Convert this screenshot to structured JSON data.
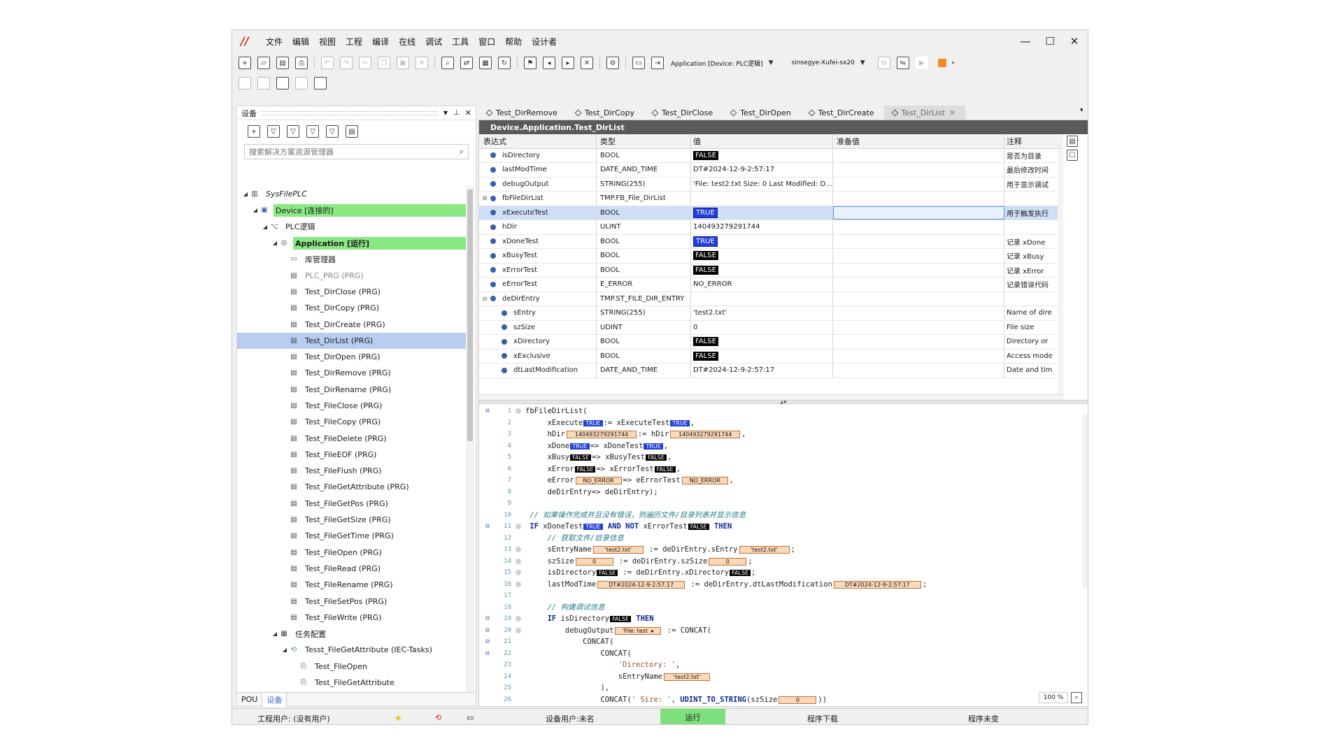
{
  "menu": [
    "文件",
    "编辑",
    "视图",
    "工程",
    "编译",
    "在线",
    "调试",
    "工具",
    "窗口",
    "帮助",
    "设计者"
  ],
  "toolbar": {
    "application_dropdown": "Application [Device: PLC逻辑]",
    "user_dropdown": "sinsegye-Xufei-sx20"
  },
  "left_panel": {
    "title": "设备",
    "search_placeholder": "搜索解决方案资源管理器",
    "tree": [
      {
        "label": "SysFilePLC",
        "level": 0,
        "exp": "◢",
        "icon": "project-icon",
        "italic": true
      },
      {
        "label": "Device [连接的]",
        "level": 1,
        "exp": "◢",
        "icon": "device-icon",
        "hl": "green"
      },
      {
        "label": "PLC逻辑",
        "level": 2,
        "exp": "◢",
        "icon": "plc-logic-icon"
      },
      {
        "label": "Application [运行]",
        "level": 3,
        "exp": "◢",
        "icon": "application-icon",
        "hl": "green",
        "bold": true
      },
      {
        "label": "库管理器",
        "level": 4,
        "exp": "",
        "icon": "library-manager-icon"
      },
      {
        "label": "PLC_PRG (PRG)",
        "level": 4,
        "exp": "",
        "icon": "pou-icon",
        "dim": true
      },
      {
        "label": "Test_DirClose (PRG)",
        "level": 4,
        "exp": "",
        "icon": "pou-icon"
      },
      {
        "label": "Test_DirCopy (PRG)",
        "level": 4,
        "exp": "",
        "icon": "pou-icon"
      },
      {
        "label": "Test_DirCreate (PRG)",
        "level": 4,
        "exp": "",
        "icon": "pou-icon"
      },
      {
        "label": "Test_DirList (PRG)",
        "level": 4,
        "exp": "",
        "icon": "pou-icon",
        "hl": "sel"
      },
      {
        "label": "Test_DirOpen (PRG)",
        "level": 4,
        "exp": "",
        "icon": "pou-icon"
      },
      {
        "label": "Test_DirRemove (PRG)",
        "level": 4,
        "exp": "",
        "icon": "pou-icon"
      },
      {
        "label": "Test_DirRename (PRG)",
        "level": 4,
        "exp": "",
        "icon": "pou-icon"
      },
      {
        "label": "Test_FileClose (PRG)",
        "level": 4,
        "exp": "",
        "icon": "pou-icon"
      },
      {
        "label": "Test_FileCopy (PRG)",
        "level": 4,
        "exp": "",
        "icon": "pou-icon"
      },
      {
        "label": "Test_FileDelete (PRG)",
        "level": 4,
        "exp": "",
        "icon": "pou-icon"
      },
      {
        "label": "Test_FileEOF (PRG)",
        "level": 4,
        "exp": "",
        "icon": "pou-icon"
      },
      {
        "label": "Test_FileFlush (PRG)",
        "level": 4,
        "exp": "",
        "icon": "pou-icon"
      },
      {
        "label": "Test_FileGetAttribute (PRG)",
        "level": 4,
        "exp": "",
        "icon": "pou-icon"
      },
      {
        "label": "Test_FileGetPos (PRG)",
        "level": 4,
        "exp": "",
        "icon": "pou-icon"
      },
      {
        "label": "Test_FileGetSize (PRG)",
        "level": 4,
        "exp": "",
        "icon": "pou-icon"
      },
      {
        "label": "Test_FileGetTime (PRG)",
        "level": 4,
        "exp": "",
        "icon": "pou-icon"
      },
      {
        "label": "Test_FileOpen (PRG)",
        "level": 4,
        "exp": "",
        "icon": "pou-icon"
      },
      {
        "label": "Test_FileRead (PRG)",
        "level": 4,
        "exp": "",
        "icon": "pou-icon"
      },
      {
        "label": "Test_FileRename (PRG)",
        "level": 4,
        "exp": "",
        "icon": "pou-icon"
      },
      {
        "label": "Test_FileSetPos (PRG)",
        "level": 4,
        "exp": "",
        "icon": "pou-icon"
      },
      {
        "label": "Test_FileWrite (PRG)",
        "level": 4,
        "exp": "",
        "icon": "pou-icon"
      },
      {
        "label": "任务配置",
        "level": 3,
        "exp": "◢",
        "icon": "task-config-icon"
      },
      {
        "label": "Tesst_FileGetAttribute (IEC-Tasks)",
        "level": 4,
        "exp": "◢",
        "icon": "task-icon"
      },
      {
        "label": "Test_FileOpen",
        "level": 5,
        "exp": "",
        "icon": "program-call-icon"
      },
      {
        "label": "Test_FileGetAttribute",
        "level": 5,
        "exp": "",
        "icon": "program-call-icon"
      }
    ],
    "tabs": [
      "POU",
      "设备"
    ]
  },
  "editor_tabs": [
    "Test_DirRemove",
    "Test_DirCopy",
    "Test_DirClose",
    "Test_DirOpen",
    "Test_DirCreate",
    "Test_DirList"
  ],
  "editor": {
    "path": "Device.Application.Test_DirList",
    "columns": [
      "表达式",
      "类型",
      "值",
      "准备值",
      "注释"
    ],
    "rows": [
      {
        "name": "isDirectory",
        "type": "BOOL",
        "value": "FALSE",
        "vstyle": "f",
        "comment": "是否为目录",
        "indent": 0,
        "exp": ""
      },
      {
        "name": "lastModTime",
        "type": "DATE_AND_TIME",
        "value": "DT#2024-12-9-2:57:17",
        "vstyle": "",
        "comment": "最后修改时间",
        "indent": 0,
        "exp": ""
      },
      {
        "name": "debugOutput",
        "type": "STRING(255)",
        "value": "'File: test2.txt Size: 0 Last Modified: D...",
        "vstyle": "",
        "comment": "用于显示调试",
        "indent": 0,
        "exp": ""
      },
      {
        "name": "fbFileDirList",
        "type": "TMP.FB_File_DirList",
        "value": "",
        "vstyle": "",
        "comment": "",
        "indent": 0,
        "exp": "⊞"
      },
      {
        "name": "xExecuteTest",
        "type": "BOOL",
        "value": "TRUE",
        "vstyle": "t",
        "comment": "用于触发执行",
        "indent": 0,
        "exp": "",
        "selected": true
      },
      {
        "name": "hDir",
        "type": "ULINT",
        "value": "140493279291744",
        "vstyle": "",
        "comment": "",
        "indent": 0,
        "exp": ""
      },
      {
        "name": "xDoneTest",
        "type": "BOOL",
        "value": "TRUE",
        "vstyle": "t",
        "comment": "记录 xDone",
        "indent": 0,
        "exp": ""
      },
      {
        "name": "xBusyTest",
        "type": "BOOL",
        "value": "FALSE",
        "vstyle": "f",
        "comment": "记录 xBusy",
        "indent": 0,
        "exp": ""
      },
      {
        "name": "xErrorTest",
        "type": "BOOL",
        "value": "FALSE",
        "vstyle": "f",
        "comment": "记录 xError",
        "indent": 0,
        "exp": ""
      },
      {
        "name": "eErrorTest",
        "type": "E_ERROR",
        "value": "NO_ERROR",
        "vstyle": "",
        "comment": "记录错误代码",
        "indent": 0,
        "exp": ""
      },
      {
        "name": "deDirEntry",
        "type": "TMP.ST_FILE_DIR_ENTRY",
        "value": "",
        "vstyle": "",
        "comment": "",
        "indent": 0,
        "exp": "⊟"
      },
      {
        "name": "sEntry",
        "type": "STRING(255)",
        "value": "'test2.txt'",
        "vstyle": "",
        "comment": "Name of dire",
        "indent": 1,
        "exp": ""
      },
      {
        "name": "szSize",
        "type": "UDINT",
        "value": "0",
        "vstyle": "",
        "comment": "File size",
        "indent": 1,
        "exp": ""
      },
      {
        "name": "xDirectory",
        "type": "BOOL",
        "value": "FALSE",
        "vstyle": "f",
        "comment": "Directory or",
        "indent": 1,
        "exp": ""
      },
      {
        "name": "xExclusive",
        "type": "BOOL",
        "value": "FALSE",
        "vstyle": "f",
        "comment": "Access mode",
        "indent": 1,
        "exp": ""
      },
      {
        "name": "dtLastModification",
        "type": "DATE_AND_TIME",
        "value": "DT#2024-12-9-2:57:17",
        "vstyle": "",
        "comment": "Date and tim",
        "indent": 1,
        "exp": ""
      }
    ],
    "code": [
      {
        "n": "1",
        "g": "⊟",
        "bp": true,
        "parts": [
          [
            "t",
            "fbFileDirList("
          ]
        ]
      },
      {
        "n": "2",
        "g": "",
        "bp": false,
        "parts": [
          [
            "t",
            "     xExecute"
          ],
          [
            "bt",
            "TRUE"
          ],
          [
            "t",
            ":= xExecuteTest"
          ],
          [
            "bt",
            "TRUE"
          ],
          [
            "t",
            ","
          ]
        ]
      },
      {
        "n": "3",
        "g": "",
        "bp": false,
        "parts": [
          [
            "t",
            "     hDir"
          ],
          [
            "bo",
            "140493279291744",
            100
          ],
          [
            "t",
            ":= hDir"
          ],
          [
            "bo",
            "140493279291744",
            100
          ],
          [
            "t",
            ","
          ]
        ]
      },
      {
        "n": "4",
        "g": "",
        "bp": false,
        "parts": [
          [
            "t",
            "     xDone"
          ],
          [
            "bt",
            "TRUE"
          ],
          [
            "t",
            "=> xDoneTest"
          ],
          [
            "bt",
            "TRUE"
          ],
          [
            "t",
            ","
          ]
        ]
      },
      {
        "n": "5",
        "g": "",
        "bp": false,
        "parts": [
          [
            "t",
            "     xBusy"
          ],
          [
            "bf",
            "FALSE"
          ],
          [
            "t",
            "=> xBusyTest"
          ],
          [
            "bf",
            "FALSE"
          ],
          [
            "t",
            ","
          ]
        ]
      },
      {
        "n": "6",
        "g": "",
        "bp": false,
        "parts": [
          [
            "t",
            "     xError"
          ],
          [
            "bf",
            "FALSE"
          ],
          [
            "t",
            "=> xErrorTest"
          ],
          [
            "bf",
            "FALSE"
          ],
          [
            "t",
            ","
          ]
        ]
      },
      {
        "n": "7",
        "g": "",
        "bp": false,
        "parts": [
          [
            "t",
            "     eError"
          ],
          [
            "bo",
            "NO_ERROR",
            66
          ],
          [
            "t",
            "=> eErrorTest"
          ],
          [
            "bo",
            "NO_ERROR",
            66
          ],
          [
            "t",
            ","
          ]
        ]
      },
      {
        "n": "8",
        "g": "",
        "bp": false,
        "parts": [
          [
            "t",
            "     deDirEntry=> deDirEntry);"
          ]
        ]
      },
      {
        "n": "9",
        "g": "",
        "bp": false,
        "parts": [
          [
            "t",
            ""
          ]
        ]
      },
      {
        "n": "10",
        "g": "",
        "bp": false,
        "parts": [
          [
            "c",
            " // 如果操作完成并且没有错误，则遍历文件/目录列表并显示信息"
          ]
        ]
      },
      {
        "n": "11",
        "g": "⊟",
        "bp": true,
        "parts": [
          [
            "k",
            " IF "
          ],
          [
            "t",
            "xDoneTest"
          ],
          [
            "bt",
            "TRUE"
          ],
          [
            "k",
            " AND NOT "
          ],
          [
            "t",
            "xErrorTest"
          ],
          [
            "bf",
            "FALSE"
          ],
          [
            "k",
            " THEN"
          ]
        ]
      },
      {
        "n": "12",
        "g": "",
        "bp": false,
        "parts": [
          [
            "c",
            "     // 获取文件/目录信息"
          ]
        ]
      },
      {
        "n": "13",
        "g": "",
        "bp": true,
        "parts": [
          [
            "t",
            "     sEntryName"
          ],
          [
            "bo",
            "'test2.txt'",
            72
          ],
          [
            "t",
            " := deDirEntry.sEntry"
          ],
          [
            "bo",
            "'test2.txt'",
            72
          ],
          [
            "t",
            ";"
          ]
        ]
      },
      {
        "n": "14",
        "g": "",
        "bp": true,
        "parts": [
          [
            "t",
            "     szSize"
          ],
          [
            "bo",
            "0",
            54
          ],
          [
            "t",
            " := deDirEntry.szSize"
          ],
          [
            "bo",
            "0",
            54
          ],
          [
            "t",
            ";"
          ]
        ]
      },
      {
        "n": "15",
        "g": "",
        "bp": true,
        "parts": [
          [
            "t",
            "     isDirectory"
          ],
          [
            "bf",
            "FALSE"
          ],
          [
            "t",
            " := deDirEntry.xDirectory"
          ],
          [
            "bf",
            "FALSE"
          ],
          [
            "t",
            ";"
          ]
        ]
      },
      {
        "n": "16",
        "g": "",
        "bp": true,
        "parts": [
          [
            "t",
            "     lastModTime"
          ],
          [
            "bo",
            "DT#2024-12-9-2:57:17",
            125
          ],
          [
            "t",
            " := deDirEntry.dtLastModification"
          ],
          [
            "bo",
            "DT#2024-12-9-2:57:17",
            125
          ],
          [
            "t",
            ";"
          ]
        ]
      },
      {
        "n": "17",
        "g": "",
        "bp": false,
        "parts": [
          [
            "t",
            ""
          ]
        ]
      },
      {
        "n": "18",
        "g": "",
        "bp": false,
        "parts": [
          [
            "c",
            "     // 构建调试信息"
          ]
        ]
      },
      {
        "n": "19",
        "g": "⊟",
        "bp": true,
        "parts": [
          [
            "k",
            "     IF "
          ],
          [
            "t",
            "isDirectory"
          ],
          [
            "bf",
            "FALSE"
          ],
          [
            "k",
            " THEN"
          ]
        ]
      },
      {
        "n": "20",
        "g": "⊟",
        "bp": true,
        "parts": [
          [
            "t",
            "         debugOutput"
          ],
          [
            "bo",
            "'File: test  ▸",
            66
          ],
          [
            "t",
            " := CONCAT("
          ]
        ]
      },
      {
        "n": "21",
        "g": "⊟",
        "bp": false,
        "parts": [
          [
            "t",
            "             CONCAT("
          ]
        ]
      },
      {
        "n": "22",
        "g": "⊟",
        "bp": false,
        "parts": [
          [
            "t",
            "                 CONCAT("
          ]
        ]
      },
      {
        "n": "23",
        "g": "",
        "bp": false,
        "parts": [
          [
            "s",
            "                     'Directory: '"
          ],
          [
            "t",
            ","
          ]
        ]
      },
      {
        "n": "24",
        "g": "",
        "bp": false,
        "parts": [
          [
            "t",
            "                     sEntryName"
          ],
          [
            "bo",
            "'test2.txt'",
            66
          ]
        ]
      },
      {
        "n": "25",
        "g": "",
        "bp": false,
        "parts": [
          [
            "t",
            "                 ),"
          ]
        ]
      },
      {
        "n": "26",
        "g": "",
        "bp": false,
        "parts": [
          [
            "t",
            "                 CONCAT("
          ],
          [
            "s",
            "' Size: '"
          ],
          [
            "t",
            ", "
          ],
          [
            "k",
            "UDINT_TO_STRING"
          ],
          [
            "t",
            "(szSize"
          ],
          [
            "bo",
            "0",
            54
          ],
          [
            "t",
            "))"
          ]
        ]
      }
    ],
    "zoom": "100 %"
  },
  "statusbar": {
    "user": "工程用户: (没有用户)",
    "device_user": "设备用户:未名",
    "run_state": "运行",
    "download": "程序下载",
    "change": "程序未变"
  }
}
